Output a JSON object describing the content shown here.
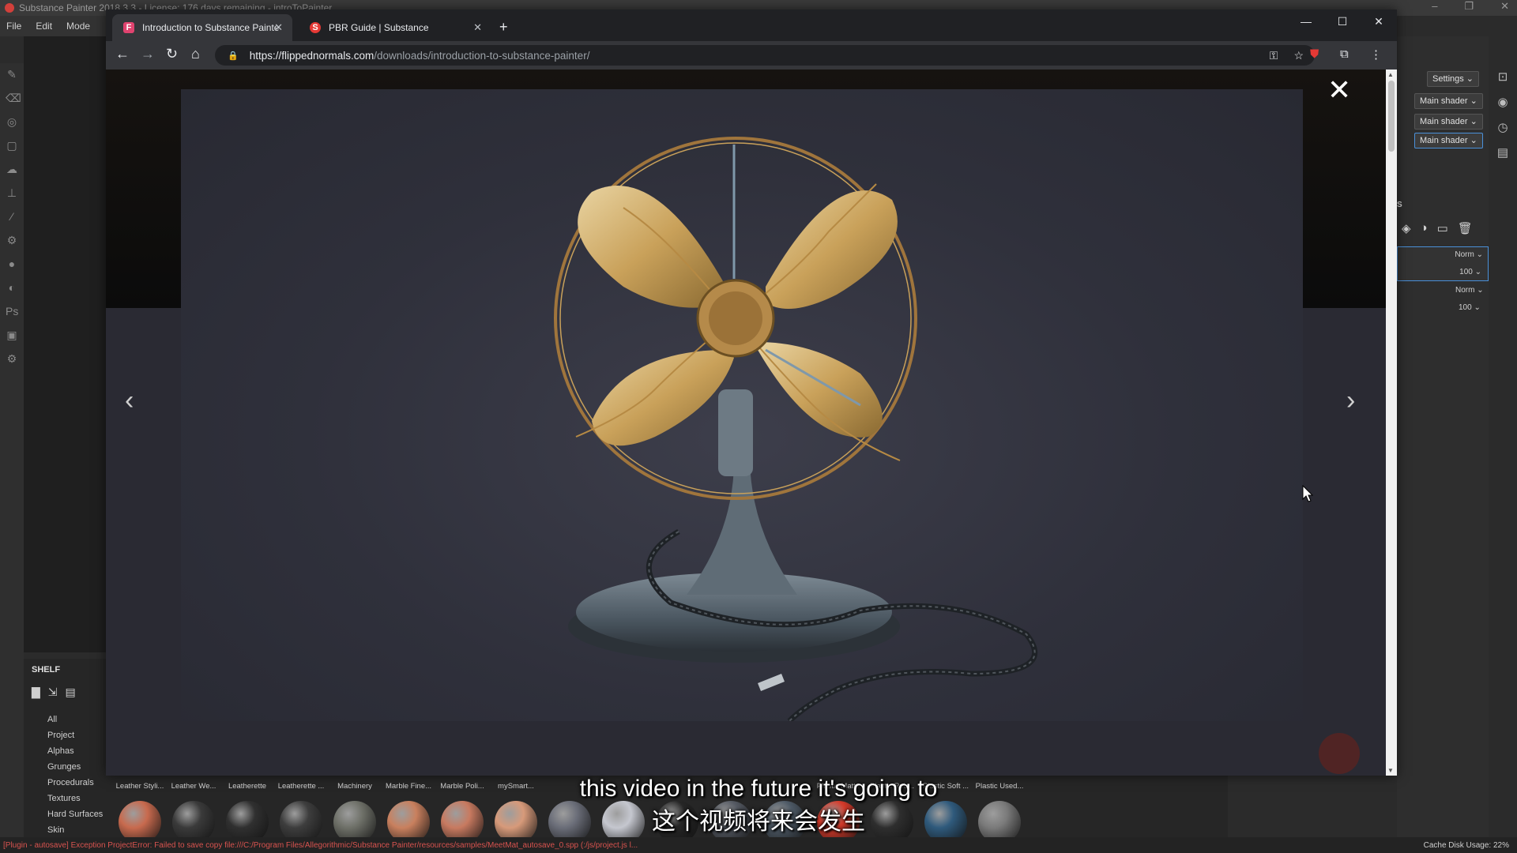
{
  "app": {
    "title": "Substance Painter 2018.3.3 - License: 176 days remaining - introToPainter",
    "menu": [
      "File",
      "Edit",
      "Mode"
    ],
    "window_controls": [
      "–",
      "❐",
      "✕"
    ]
  },
  "right_panel": {
    "settings_label": "Settings",
    "shader_dropdowns": [
      "Main shader",
      "Main shader",
      "Main shader"
    ],
    "section_label": "S",
    "layers": [
      {
        "blend": "Norm",
        "opacity": "100"
      },
      {
        "blend": "Norm",
        "opacity": "100"
      }
    ]
  },
  "shelf": {
    "title": "SHELF",
    "categories": [
      "All",
      "Project",
      "Alphas",
      "Grunges",
      "Procedurals",
      "Textures",
      "Hard Surfaces",
      "Skin"
    ]
  },
  "materials": [
    {
      "label": "Leather Styli...",
      "color": "#c86a4e"
    },
    {
      "label": "Leather We...",
      "color": "#3a3a3a"
    },
    {
      "label": "Leatherette",
      "color": "#303030"
    },
    {
      "label": "Leatherette ...",
      "color": "#3d3d3d"
    },
    {
      "label": "Machinery",
      "color": "#6e7068"
    },
    {
      "label": "Marble Fine...",
      "color": "#c9805e"
    },
    {
      "label": "Marble Poli...",
      "color": "#c87a60"
    },
    {
      "label": "mySmart...",
      "color": "#d79a7a"
    },
    {
      "label": "",
      "color": "#6a6d78"
    },
    {
      "label": "",
      "color": "#c5c7cf"
    },
    {
      "label": "",
      "color": "#262626"
    },
    {
      "label": "",
      "color": "#555a63"
    },
    {
      "label": "",
      "color": "#4e5a66"
    },
    {
      "label": "Plastic Matte",
      "color": "#d53a2a"
    },
    {
      "label": "Plastic Rub...",
      "color": "#2e2e2e"
    },
    {
      "label": "Plastic Soft ...",
      "color": "#2f5a7c"
    },
    {
      "label": "Plastic Used...",
      "color": "#7a7a7a"
    }
  ],
  "status": {
    "error": "[Plugin - autosave] Exception ProjectError: Failed to save copy file:///C:/Program Files/Allegorithmic/Substance Painter/resources/samples/MeetMat_autosave_0.spp (:/js/project.js l...",
    "cache": "Cache Disk Usage:   22%"
  },
  "browser": {
    "tabs": [
      {
        "title": "Introduction to Substance Painte",
        "favicon": "F",
        "favicon_color": "#e0436f",
        "active": true
      },
      {
        "title": "PBR Guide | Substance",
        "favicon": "S",
        "favicon_color": "#e53935",
        "active": false
      }
    ],
    "new_tab": "+",
    "window_controls": [
      "—",
      "☐",
      "✕"
    ],
    "url_host": "https://flippednormals.com",
    "url_path": "/downloads/introduction-to-substance-painter/",
    "lightbox_close": "✕",
    "prev_arrow": "‹",
    "next_arrow": "›"
  },
  "subtitles": {
    "line1": "this video in the future it's going to",
    "line2": "这个视频将来会发生"
  },
  "colors": {
    "error_red": "#d9534f",
    "selection_blue": "#4a90d9",
    "brass": "#c9a15a"
  }
}
